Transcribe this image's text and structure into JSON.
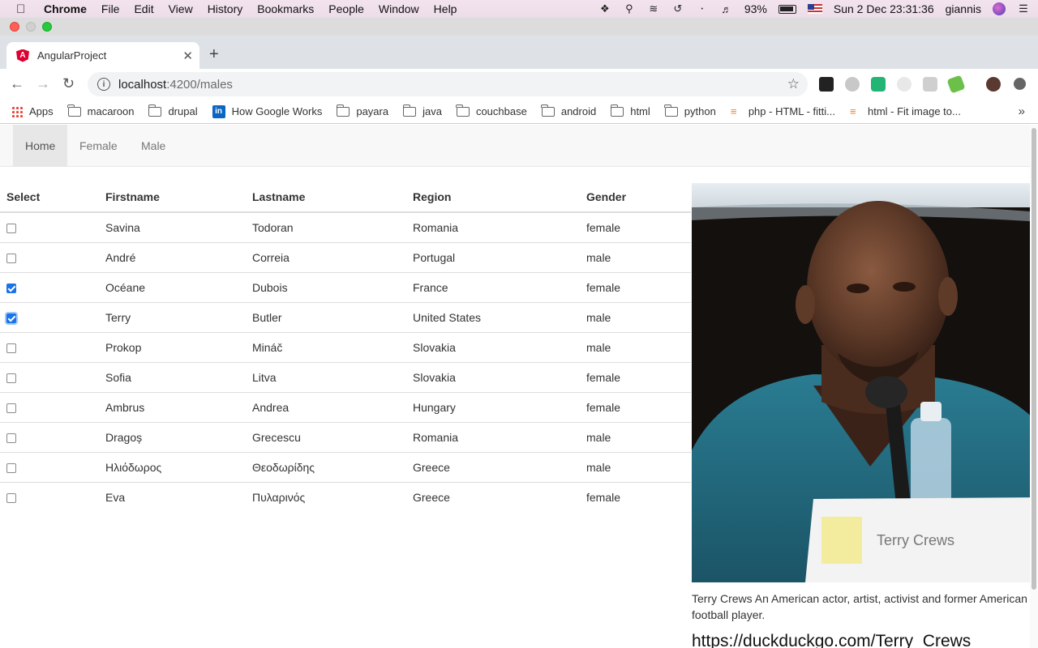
{
  "menubar": {
    "app": "Chrome",
    "items": [
      "File",
      "Edit",
      "View",
      "History",
      "Bookmarks",
      "People",
      "Window",
      "Help"
    ],
    "battery": "93%",
    "datetime": "Sun 2 Dec  23:31:36",
    "user": "giannis"
  },
  "browser": {
    "tab_title": "AngularProject",
    "url_host": "localhost",
    "url_path": ":4200/males"
  },
  "bookmarks": [
    "Apps",
    "macaroon",
    "drupal",
    "How Google Works",
    "payara",
    "java",
    "couchbase",
    "android",
    "html",
    "python",
    "php - HTML - fitti...",
    "html - Fit image to..."
  ],
  "nav": {
    "links": [
      "Home",
      "Female",
      "Male"
    ],
    "active": "Home"
  },
  "table": {
    "headers": [
      "Select",
      "Firstname",
      "Lastname",
      "Region",
      "Gender"
    ],
    "rows": [
      {
        "checked": false,
        "firstname": "Savina",
        "lastname": "Todoran",
        "region": "Romania",
        "gender": "female"
      },
      {
        "checked": false,
        "firstname": "André",
        "lastname": "Correia",
        "region": "Portugal",
        "gender": "male"
      },
      {
        "checked": true,
        "firstname": "Océane",
        "lastname": "Dubois",
        "region": "France",
        "gender": "female"
      },
      {
        "checked": true,
        "firstname": "Terry",
        "lastname": "Butler",
        "region": "United States",
        "gender": "male"
      },
      {
        "checked": false,
        "firstname": "Prokop",
        "lastname": "Mináč",
        "region": "Slovakia",
        "gender": "male"
      },
      {
        "checked": false,
        "firstname": "Sofia",
        "lastname": "Litva",
        "region": "Slovakia",
        "gender": "female"
      },
      {
        "checked": false,
        "firstname": "Ambrus",
        "lastname": "Andrea",
        "region": "Hungary",
        "gender": "female"
      },
      {
        "checked": false,
        "firstname": "Dragoș",
        "lastname": "Grecescu",
        "region": "Romania",
        "gender": "male"
      },
      {
        "checked": false,
        "firstname": "Ηλιόδωρος",
        "lastname": "Θεοδωρίδης",
        "region": "Greece",
        "gender": "male"
      },
      {
        "checked": false,
        "firstname": "Eva",
        "lastname": "Πυλαρινός",
        "region": "Greece",
        "gender": "female"
      }
    ]
  },
  "profile": {
    "placard": "Terry Crews",
    "caption": "Terry Crews An American actor, artist, activist and former American football player.",
    "link": "https://duckduckgo.com/Terry_Crews"
  }
}
